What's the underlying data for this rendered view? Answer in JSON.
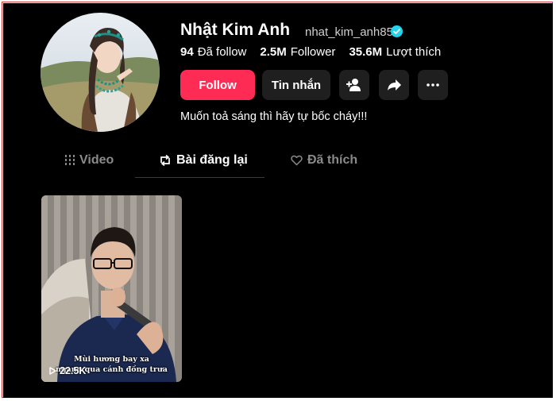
{
  "profile": {
    "display_name": "Nhật Kim Anh",
    "username": "nhat_kim_anh85",
    "verified": true,
    "bio": "Muốn toả sáng thì hãy tự bốc cháy!!!"
  },
  "stats": [
    {
      "value": "94",
      "label": "Đã follow"
    },
    {
      "value": "2.5M",
      "label": "Follower"
    },
    {
      "value": "35.6M",
      "label": "Lượt thích"
    }
  ],
  "actions": {
    "follow": "Follow",
    "message": "Tin nhắn",
    "icons": [
      "add-friend-icon",
      "share-icon",
      "more-icon"
    ]
  },
  "tabs": [
    {
      "label": "Video",
      "icon": "grid-icon",
      "active": false
    },
    {
      "label": "Bài đăng lại",
      "icon": "repost-icon",
      "active": true
    },
    {
      "label": "Đã thích",
      "icon": "heart-icon",
      "active": false
    }
  ],
  "videos": [
    {
      "caption_line1": "Mùi hương bay xa",
      "caption_line2": "ngang qua cánh đồng trưa",
      "views": "22.5K"
    }
  ],
  "colors": {
    "background": "#000000",
    "accent": "#fe2c55",
    "verified": "#20d5ec",
    "button_secondary": "#1f1f1f"
  }
}
